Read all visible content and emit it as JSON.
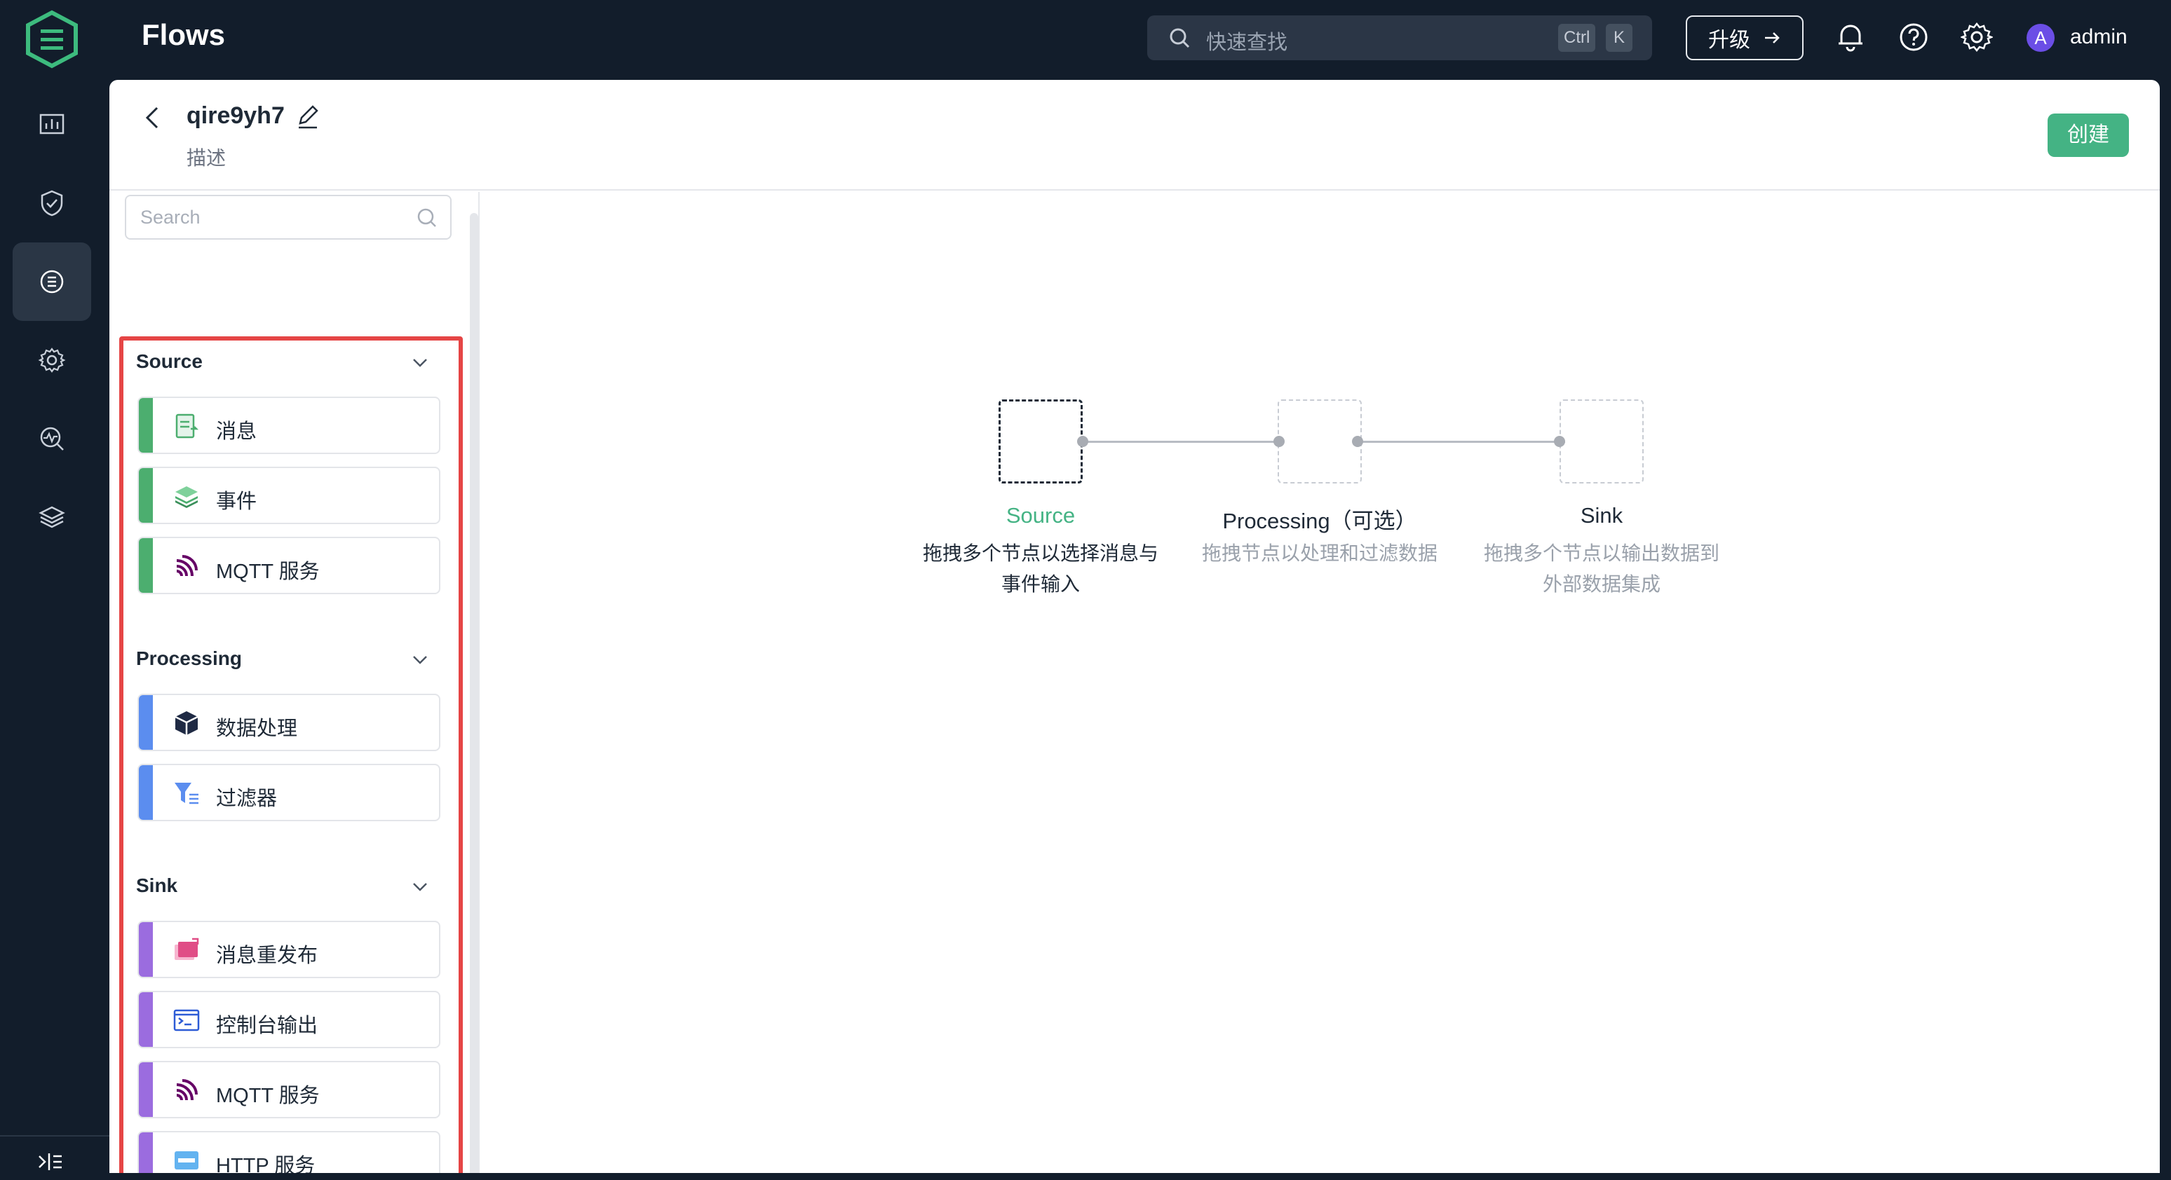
{
  "app": {
    "title": "Flows"
  },
  "search": {
    "placeholder": "快速查找",
    "shortcut_ctrl": "Ctrl",
    "shortcut_key": "K"
  },
  "topbar": {
    "upgrade_label": "升级",
    "user_initial": "A",
    "username": "admin"
  },
  "rail": {
    "items": [
      {
        "name": "dashboard-icon",
        "active": false
      },
      {
        "name": "shield-icon",
        "active": false
      },
      {
        "name": "flows-icon",
        "active": true
      },
      {
        "name": "gear-integration-icon",
        "active": false
      },
      {
        "name": "diagnose-icon",
        "active": false
      },
      {
        "name": "layers-icon",
        "active": false
      }
    ]
  },
  "flow": {
    "name": "qire9yh7",
    "description": "描述",
    "create_label": "创建"
  },
  "palette": {
    "search_placeholder": "Search",
    "groups": [
      {
        "title": "Source",
        "color": "#4cae6f",
        "items": [
          {
            "label": "消息",
            "icon": "message-doc-icon"
          },
          {
            "label": "事件",
            "icon": "event-layers-icon"
          },
          {
            "label": "MQTT 服务",
            "icon": "mqtt-icon"
          }
        ]
      },
      {
        "title": "Processing",
        "color": "#5b8def",
        "items": [
          {
            "label": "数据处理",
            "icon": "cube-icon"
          },
          {
            "label": "过滤器",
            "icon": "filter-icon"
          }
        ]
      },
      {
        "title": "Sink",
        "color": "#9b6cdf",
        "items": [
          {
            "label": "消息重发布",
            "icon": "republish-icon"
          },
          {
            "label": "控制台输出",
            "icon": "console-icon"
          },
          {
            "label": "MQTT 服务",
            "icon": "mqtt-icon"
          },
          {
            "label": "HTTP 服务",
            "icon": "http-icon"
          }
        ]
      }
    ]
  },
  "canvas": {
    "steps": [
      {
        "title": "Source",
        "desc_line1": "拖拽多个节点以选择消息与",
        "desc_line2": "事件输入",
        "title_color": "#44b384",
        "desc_color": "#1f2a37"
      },
      {
        "title": "Processing（可选）",
        "desc_line1": "拖拽节点以处理和过滤数据",
        "desc_line2": "",
        "title_color": "#1f2a37",
        "desc_color": "#9aa1ab"
      },
      {
        "title": "Sink",
        "desc_line1": "拖拽多个节点以输出数据到",
        "desc_line2": "外部数据集成",
        "title_color": "#1f2a37",
        "desc_color": "#9aa1ab"
      }
    ]
  }
}
